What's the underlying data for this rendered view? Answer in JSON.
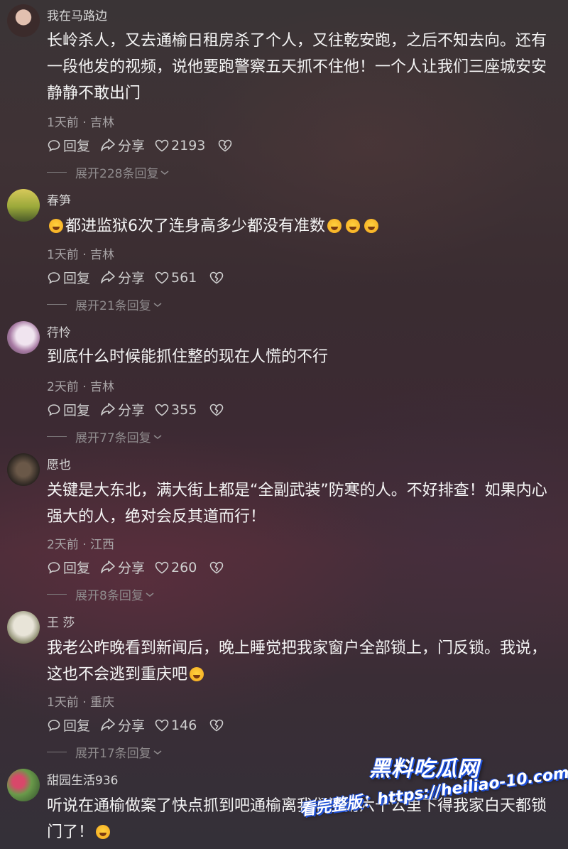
{
  "comments": [
    {
      "username": "我在马路边",
      "text": "长岭杀人，又去通榆日租房杀了个人，又往乾安跑，之后不知去向。还有一段他发的视频，说他要跑警察五天抓不住他！一个人让我们三座城安安静静不敢出门",
      "meta": "1天前 · 吉林",
      "reply_label": "回复",
      "share_label": "分享",
      "likes": "2193",
      "expand_label": "展开228条回复",
      "avatar_colors": [
        "#c9a39a",
        "#3a2a2a"
      ]
    },
    {
      "username": "春笋",
      "text": "都进监狱6次了连身高多少都没有准数",
      "meta": "1天前 · 吉林",
      "reply_label": "回复",
      "share_label": "分享",
      "likes": "561",
      "expand_label": "展开21条回复",
      "avatar_colors": [
        "#c9b23a",
        "#6a7a2a"
      ]
    },
    {
      "username": "荇怜",
      "text": "到底什么时候能抓住整的现在人慌的不行",
      "meta": "2天前 · 吉林",
      "reply_label": "回复",
      "share_label": "分享",
      "likes": "355",
      "expand_label": "展开77条回复",
      "avatar_colors": [
        "#e6d6e6",
        "#8a6a8a"
      ]
    },
    {
      "username": "愿也",
      "text": "关键是大东北，满大街上都是“全副武装”防寒的人。不好排查！如果内心强大的人，绝对会反其道而行！",
      "meta": "2天前 · 江西",
      "reply_label": "回复",
      "share_label": "分享",
      "likes": "260",
      "expand_label": "展开8条回复",
      "avatar_colors": [
        "#5a4a3a",
        "#2a2220"
      ]
    },
    {
      "username": "王 莎",
      "text": "我老公昨晚看到新闻后，晚上睡觉把我家窗户全部锁上，门反锁。我说，这也不会逃到重庆吧",
      "meta": "1天前 · 重庆",
      "reply_label": "回复",
      "share_label": "分享",
      "likes": "146",
      "expand_label": "展开17条回复",
      "avatar_colors": [
        "#d8d4c8",
        "#8a8a6a"
      ]
    },
    {
      "username": "甜园生活936",
      "text": "听说在通榆做案了快点抓到吧通榆离我们洮南六十公里下得我家白天都锁门了！",
      "meta": "",
      "reply_label": "",
      "share_label": "",
      "likes": "",
      "expand_label": "",
      "avatar_colors": [
        "#c24a6a",
        "#3a6a3a"
      ]
    }
  ],
  "watermark": {
    "title": "黑料吃瓜网",
    "url": "看完整版：https://heiliao-10.com"
  }
}
